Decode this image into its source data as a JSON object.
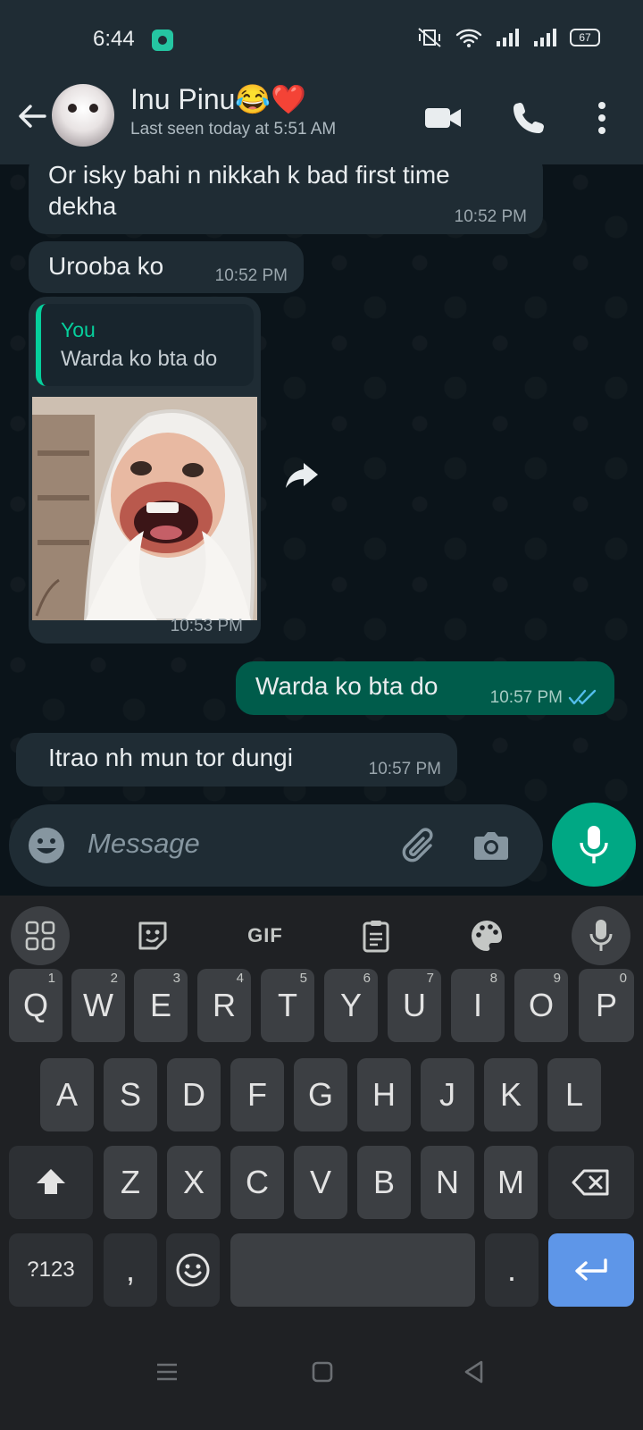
{
  "status_bar": {
    "time": "6:44",
    "battery": "67"
  },
  "header": {
    "contact_name": "Inu Pinu😂❤️",
    "last_seen": "Last seen today at 5:51 AM"
  },
  "messages": [
    {
      "text": "Or isky bahi n nikkah k bad first time dekha",
      "time": "10:52 PM"
    },
    {
      "text": "Urooba ko",
      "time": "10:52 PM"
    },
    {
      "quote_author": "You",
      "quote_text": "Warda ko bta do",
      "time": "10:53 PM"
    },
    {
      "text": "Warda ko bta do",
      "time": "10:57 PM"
    },
    {
      "text": "Itrao nh mun tor dungi",
      "time": "10:57 PM"
    }
  ],
  "composer": {
    "placeholder": "Message"
  },
  "keyboard": {
    "toolbar_gif": "GIF",
    "row1": [
      "Q",
      "W",
      "E",
      "R",
      "T",
      "Y",
      "U",
      "I",
      "O",
      "P"
    ],
    "row1_hints": [
      "1",
      "2",
      "3",
      "4",
      "5",
      "6",
      "7",
      "8",
      "9",
      "0"
    ],
    "row2": [
      "A",
      "S",
      "D",
      "F",
      "G",
      "H",
      "J",
      "K",
      "L"
    ],
    "row3": [
      "Z",
      "X",
      "C",
      "V",
      "B",
      "N",
      "M"
    ],
    "symbols_key": "?123",
    "comma_key": ",",
    "period_key": "."
  },
  "colors": {
    "header_bg": "#1f2c34",
    "chat_bg": "#0b141a",
    "incoming_bubble": "#1f2c34",
    "outgoing_bubble": "#005c4b",
    "accent_green": "#00a884",
    "read_ticks": "#53bdeb",
    "enter_key": "#5e96e8"
  }
}
